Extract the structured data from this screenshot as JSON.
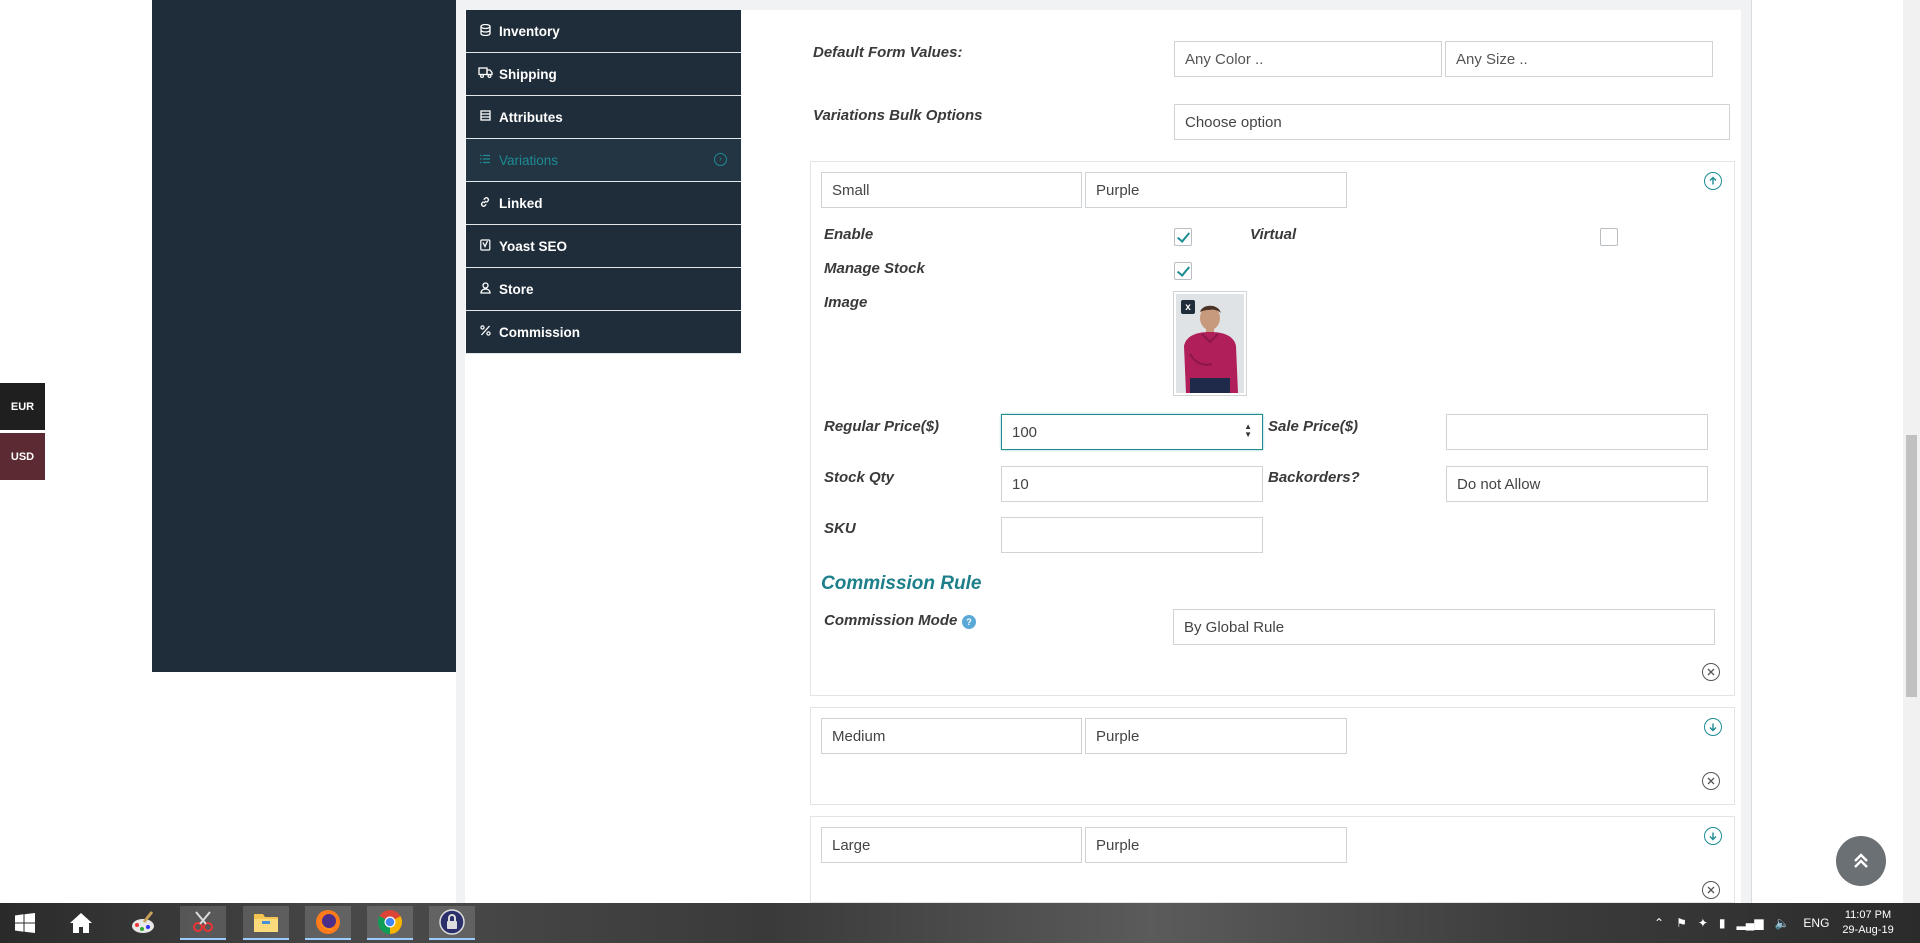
{
  "tabs": [
    {
      "label": "Inventory",
      "icon": "database-icon"
    },
    {
      "label": "Shipping",
      "icon": "truck-icon"
    },
    {
      "label": "Attributes",
      "icon": "server-icon"
    },
    {
      "label": "Variations",
      "icon": "list-icon",
      "active": true
    },
    {
      "label": "Linked",
      "icon": "link-icon"
    },
    {
      "label": "Yoast SEO",
      "icon": "yoast-icon"
    },
    {
      "label": "Store",
      "icon": "user-icon"
    },
    {
      "label": "Commission",
      "icon": "percent-icon"
    }
  ],
  "form": {
    "default_values_label": "Default Form Values:",
    "color_select": "Any Color ..",
    "size_select": "Any Size ..",
    "bulk_label": "Variations Bulk Options",
    "bulk_select": "Choose option"
  },
  "variation1": {
    "size": "Small",
    "color": "Purple",
    "enable_label": "Enable",
    "virtual_label": "Virtual",
    "manage_stock_label": "Manage Stock",
    "image_label": "Image",
    "image_remove": "x",
    "regular_price_label": "Regular Price($)",
    "regular_price": "100",
    "sale_price_label": "Sale Price($)",
    "sale_price": "",
    "stock_qty_label": "Stock Qty",
    "stock_qty": "10",
    "backorders_label": "Backorders?",
    "backorders": "Do not Allow",
    "sku_label": "SKU",
    "sku": "",
    "commission_title": "Commission Rule",
    "commission_mode_label": "Commission Mode",
    "commission_mode": "By Global Rule"
  },
  "variation2": {
    "size": "Medium",
    "color": "Purple"
  },
  "variation3": {
    "size": "Large",
    "color": "Purple"
  },
  "currency": {
    "eur": "EUR",
    "usd": "USD"
  },
  "taskbar": {
    "language": "ENG",
    "time": "11:07 PM",
    "date": "29-Aug-19"
  },
  "colors": {
    "sidebar": "#1f2d3a",
    "accent": "#1d8c93",
    "usd": "#5b2a32",
    "eur": "#1f1f1f"
  }
}
